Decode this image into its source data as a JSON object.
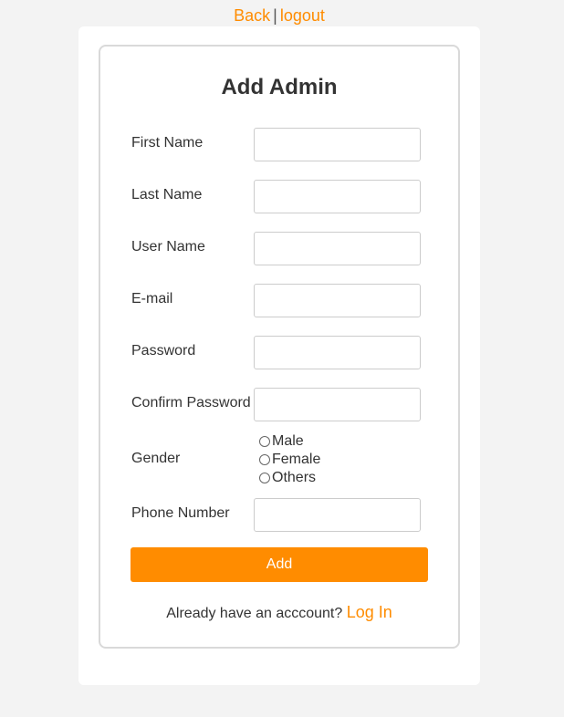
{
  "nav": {
    "back_label": "Back",
    "separator": "|",
    "logout_label": "logout"
  },
  "form": {
    "title": "Add Admin",
    "fields": {
      "first_name": {
        "label": "First Name",
        "value": ""
      },
      "last_name": {
        "label": "Last Name",
        "value": ""
      },
      "user_name": {
        "label": "User Name",
        "value": ""
      },
      "email": {
        "label": "E-mail",
        "value": ""
      },
      "password": {
        "label": "Password",
        "value": ""
      },
      "confirm_password": {
        "label": "Confirm Password",
        "value": ""
      },
      "phone_number": {
        "label": "Phone Number",
        "value": ""
      }
    },
    "gender": {
      "label": "Gender",
      "options": [
        "Male",
        "Female",
        "Others"
      ]
    },
    "submit_label": "Add",
    "account_prompt": "Already have an acccount?",
    "login_link": "Log In"
  },
  "colors": {
    "accent": "#ff8c00",
    "background": "#f3f3f3",
    "card": "#ffffff",
    "border": "#d9d9d9"
  }
}
